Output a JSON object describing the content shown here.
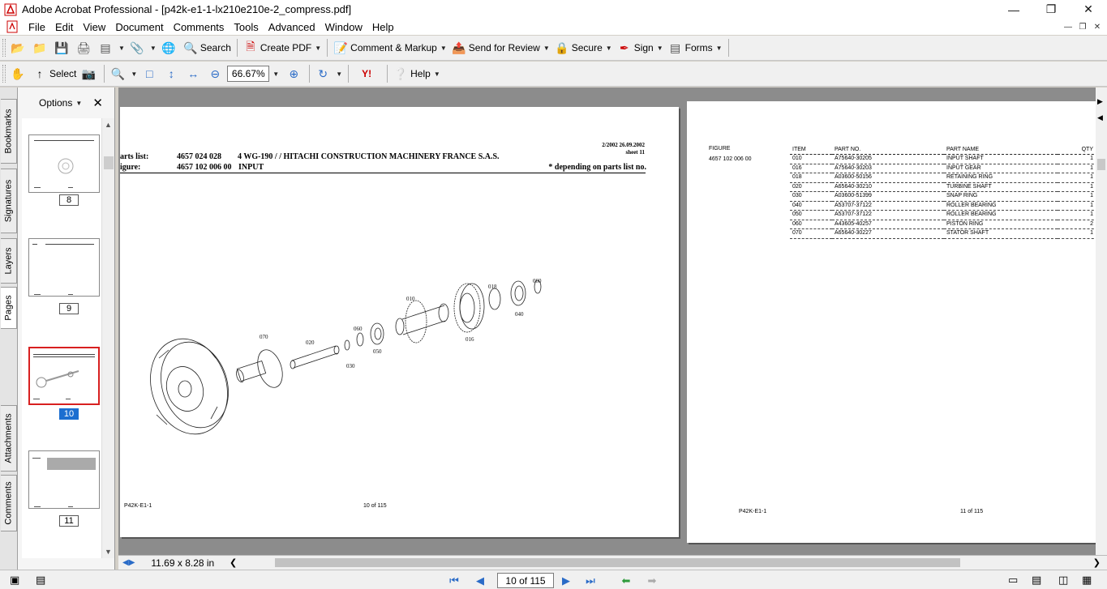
{
  "window": {
    "title": "Adobe Acrobat Professional - [p42k-e1-1-lx210e210e-2_compress.pdf]"
  },
  "menu": [
    "File",
    "Edit",
    "View",
    "Document",
    "Comments",
    "Tools",
    "Advanced",
    "Window",
    "Help"
  ],
  "toolbar1": {
    "search": "Search",
    "create_pdf": "Create PDF",
    "comment_markup": "Comment & Markup",
    "send_review": "Send for Review",
    "secure": "Secure",
    "sign": "Sign",
    "forms": "Forms"
  },
  "toolbar2": {
    "select": "Select",
    "zoom": "66.67%",
    "help": "Help"
  },
  "left_tabs": [
    "Bookmarks",
    "Signatures",
    "Layers",
    "Pages",
    "Attachments",
    "Comments"
  ],
  "pages_panel": {
    "options": "Options",
    "thumbnails": [
      {
        "label": "8",
        "selected": false
      },
      {
        "label": "9",
        "selected": false
      },
      {
        "label": "10",
        "selected": true
      },
      {
        "label": "11",
        "selected": false
      }
    ]
  },
  "page_left": {
    "date_line1": "2/2002 26.09.2002",
    "date_line2": "sheet 11",
    "row1_label": "arts list:",
    "row1_number": "4657 024 028",
    "row1_desc": "4 WG-190 /  / HITACHI CONSTRUCTION MACHINERY FRANCE S.A.S.",
    "row2_label": "igure:",
    "row2_number": "4657 102 006 00",
    "row2_desc": "INPUT",
    "row2_note": "*  depending on parts list no.",
    "footer_left": "P42K-E1-1",
    "footer_center": "10 of 115",
    "callouts": [
      "070",
      "020",
      "060",
      "030",
      "050",
      "010",
      "016",
      "018",
      "040",
      "060"
    ]
  },
  "page_right": {
    "figure_header": "FIGURE",
    "figure_value": "4657 102 006 00",
    "columns": [
      "ITEM",
      "PART NO.",
      "PART NAME",
      "QTY"
    ],
    "rows": [
      [
        "010",
        "A75640-30205",
        "INPUT SHAFT",
        "1"
      ],
      [
        "016",
        "A75640-30203",
        "INPUT GEAR",
        "1"
      ],
      [
        "018",
        "A03600-50156",
        "RETAINING RING",
        "1"
      ],
      [
        "020",
        "A65640-30210",
        "TURBINE SHAFT",
        "1"
      ],
      [
        "030",
        "A03600-51399",
        "SNAP RING",
        "1"
      ],
      [
        "040",
        "A53707-37122",
        "ROLLER BEARING",
        "1"
      ],
      [
        "050",
        "A53707-37122",
        "ROLLER BEARING",
        "1"
      ],
      [
        "060",
        "A43605-40257",
        "PISTON RING",
        "2"
      ],
      [
        "070",
        "A65640-30227",
        "STATOR SHAFT",
        "1"
      ]
    ],
    "footer_left": "P42K-E1-1",
    "footer_center": "11 of 115"
  },
  "bottom": {
    "page_size": "11.69 x 8.28 in",
    "page_nav": "10 of 115"
  }
}
